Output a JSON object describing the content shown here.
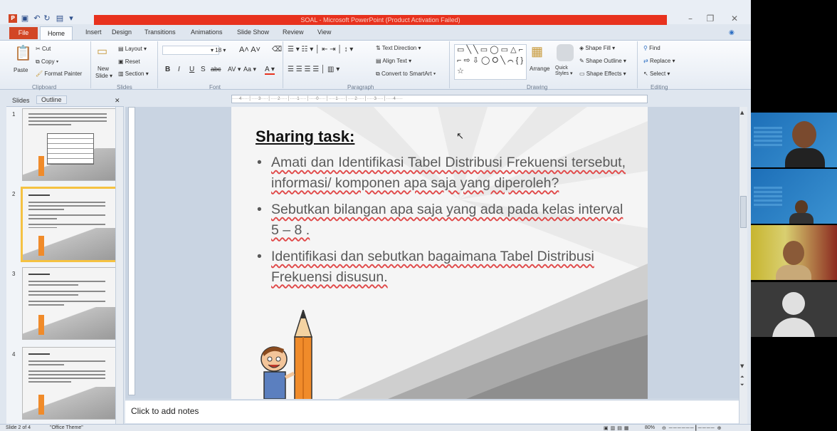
{
  "window": {
    "title": "SOAL - Microsoft PowerPoint (Product Activation Failed)",
    "app_badge": "P",
    "controls": [
      "–",
      "❐",
      "✕"
    ]
  },
  "tabs": [
    "File",
    "Home",
    "Insert",
    "Design",
    "Transitions",
    "Animations",
    "Slide Show",
    "Review",
    "View"
  ],
  "ribbon": {
    "clipboard": {
      "paste": "Paste",
      "cut": "Cut",
      "copy": "Copy ▾",
      "format_painter": "Format Painter",
      "label": "Clipboard"
    },
    "slides": {
      "new_slide": "New",
      "new_slide2": "Slide ▾",
      "layout": "Layout ▾",
      "reset": "Reset",
      "section": "Section ▾",
      "label": "Slides"
    },
    "font": {
      "size": "18",
      "label": "Font",
      "bold": "B",
      "italic": "I",
      "underline": "U",
      "strike": "S",
      "aa": "Aa ▾",
      "a": "A ▾"
    },
    "paragraph": {
      "text_direction": "Text Direction ▾",
      "align_text": "Align Text ▾",
      "smartart": "Convert to SmartArt ▾",
      "label": "Paragraph"
    },
    "drawing": {
      "arrange": "Arrange",
      "quick_styles": "Quick Styles ▾",
      "shape_fill": "Shape Fill ▾",
      "shape_outline": "Shape Outline ▾",
      "shape_effects": "Shape Effects ▾",
      "label": "Drawing"
    },
    "editing": {
      "find": "Find",
      "replace": "Replace ▾",
      "select": "Select ▾",
      "label": "Editing"
    }
  },
  "side_tabs": {
    "slides": "Slides",
    "outline": "Outline",
    "close": "✕"
  },
  "thumbnails": [
    {
      "num": "1"
    },
    {
      "num": "2"
    },
    {
      "num": "3"
    },
    {
      "num": "4"
    }
  ],
  "slide": {
    "title": "Sharing task:",
    "bullets": [
      "Amati dan Identifikasi Tabel Distribusi Frekuensi tersebut, informasi/ komponen apa saja yang diperoleh?",
      "Sebutkan bilangan apa saja yang ada pada kelas interval 5 – 8 .",
      "Identifikasi dan sebutkan bagaimana Tabel Distribusi Frekuensi disusun."
    ]
  },
  "notes": {
    "placeholder": "Click to add notes"
  },
  "status": {
    "slide": "Slide 2 of 4",
    "theme": "\"Office Theme\"",
    "zoom": "80%"
  },
  "colors": {
    "accent_red": "#e8321e",
    "file_tab": "#d24625",
    "pencil": "#f08b2a"
  }
}
